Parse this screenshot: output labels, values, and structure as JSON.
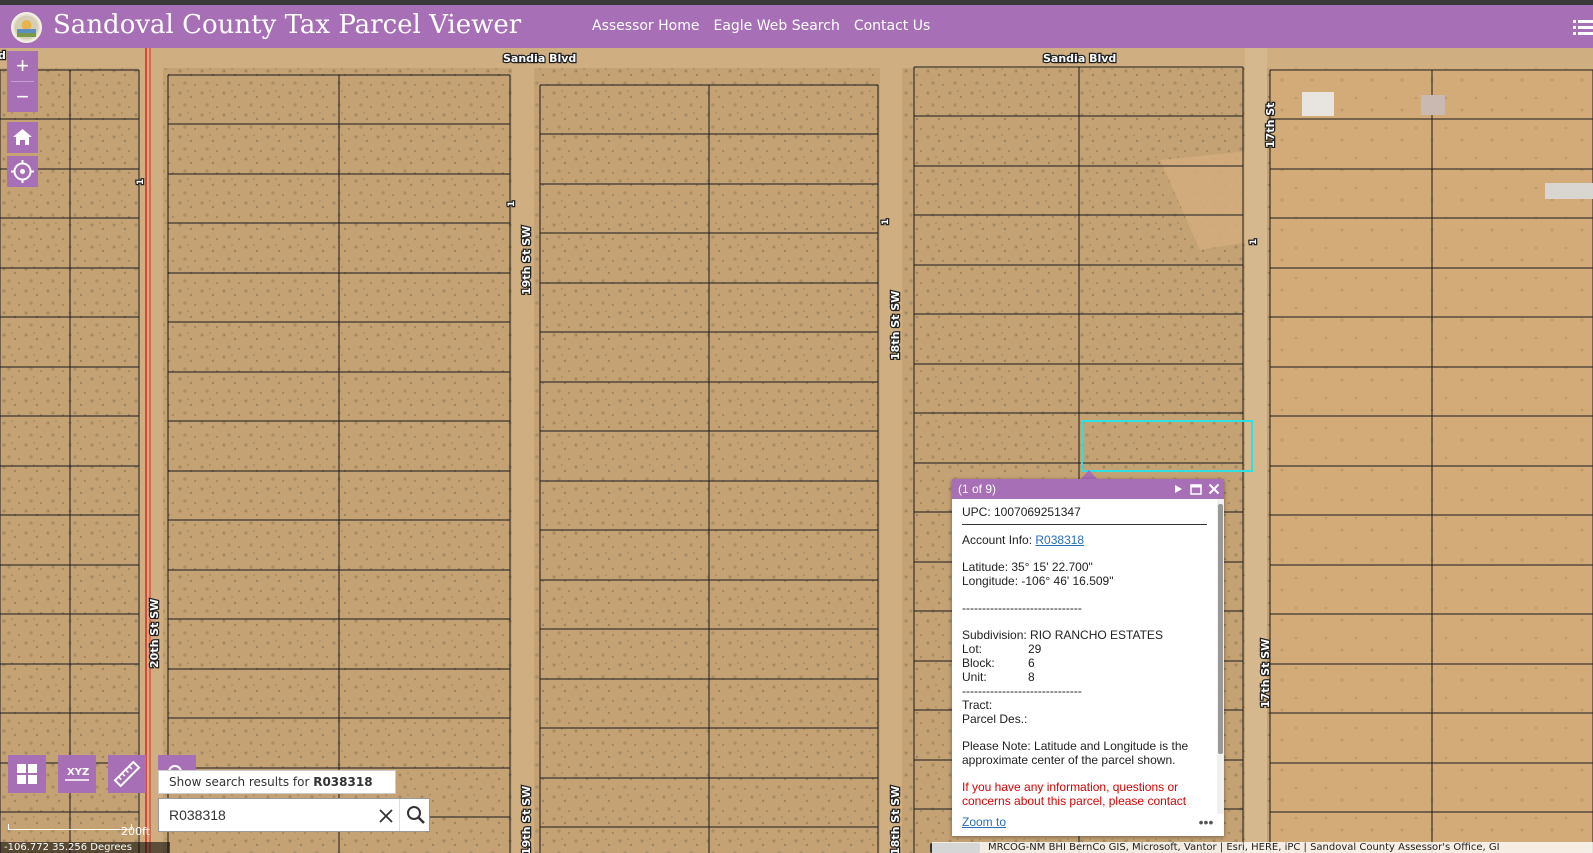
{
  "header": {
    "title": "Sandoval County Tax Parcel Viewer",
    "nav": [
      "Assessor Home",
      "Eagle Web Search",
      "Contact Us"
    ]
  },
  "map": {
    "streets": {
      "top_left": "Sandia  Blvd",
      "top_right": "Sandia  Blvd",
      "st19": "19th  St  SW",
      "st19_bottom": "19th  St  SW",
      "st18": "18th  St  SW",
      "st17_top": "17th  St",
      "st17_bottom": "17th  St  SW",
      "st20": "20th  St  SW",
      "lot1": "1",
      "cut_left": "d"
    },
    "zoom_in": "+",
    "zoom_out": "−"
  },
  "search": {
    "hint_prefix": "Show search results for ",
    "hint_term": "R038318",
    "value": "R038318"
  },
  "scale": {
    "label": "200ft"
  },
  "coords": "-106.772 35.256 Degrees",
  "attribution": "MRCOG-NM BHI BernCo GIS, Microsoft, Vantor | Esri, HERE, iPC | Sandoval County Assessor's Office, GI",
  "popup": {
    "count": "(1 of 9)",
    "upc": "UPC: 1007069251347",
    "account_label": "Account Info: ",
    "account_link": "R038318",
    "latitude": "Latitude: 35° 15' 22.700\"",
    "longitude": "Longitude: -106° 46' 16.509\"",
    "dashes": "------------------------------",
    "subdivision": "Subdivision: RIO RANCHO ESTATES",
    "lot_label": "Lot:",
    "lot": "29",
    "block_label": "Block:",
    "block": "6",
    "unit_label": "Unit:",
    "unit": "8",
    "tract": "Tract:",
    "parcel_des": "Parcel Des.:",
    "note": "Please Note: Latitude and Longitude is the approximate center of the parcel shown.",
    "info": "If you have any information, questions or concerns about this parcel, please contact",
    "zoom_to": "Zoom to",
    "more": "•••"
  },
  "colors": {
    "accent": "#a76fb5",
    "highlight": "#2fe0e0",
    "ground": "#c8a676"
  },
  "icons": [
    "app-logo-icon",
    "menu-icon",
    "home-icon",
    "locate-icon",
    "basemap-gallery-icon",
    "xyz-coordinates-icon",
    "measure-icon",
    "search-icon",
    "close-icon",
    "play-icon",
    "maximize-icon"
  ]
}
